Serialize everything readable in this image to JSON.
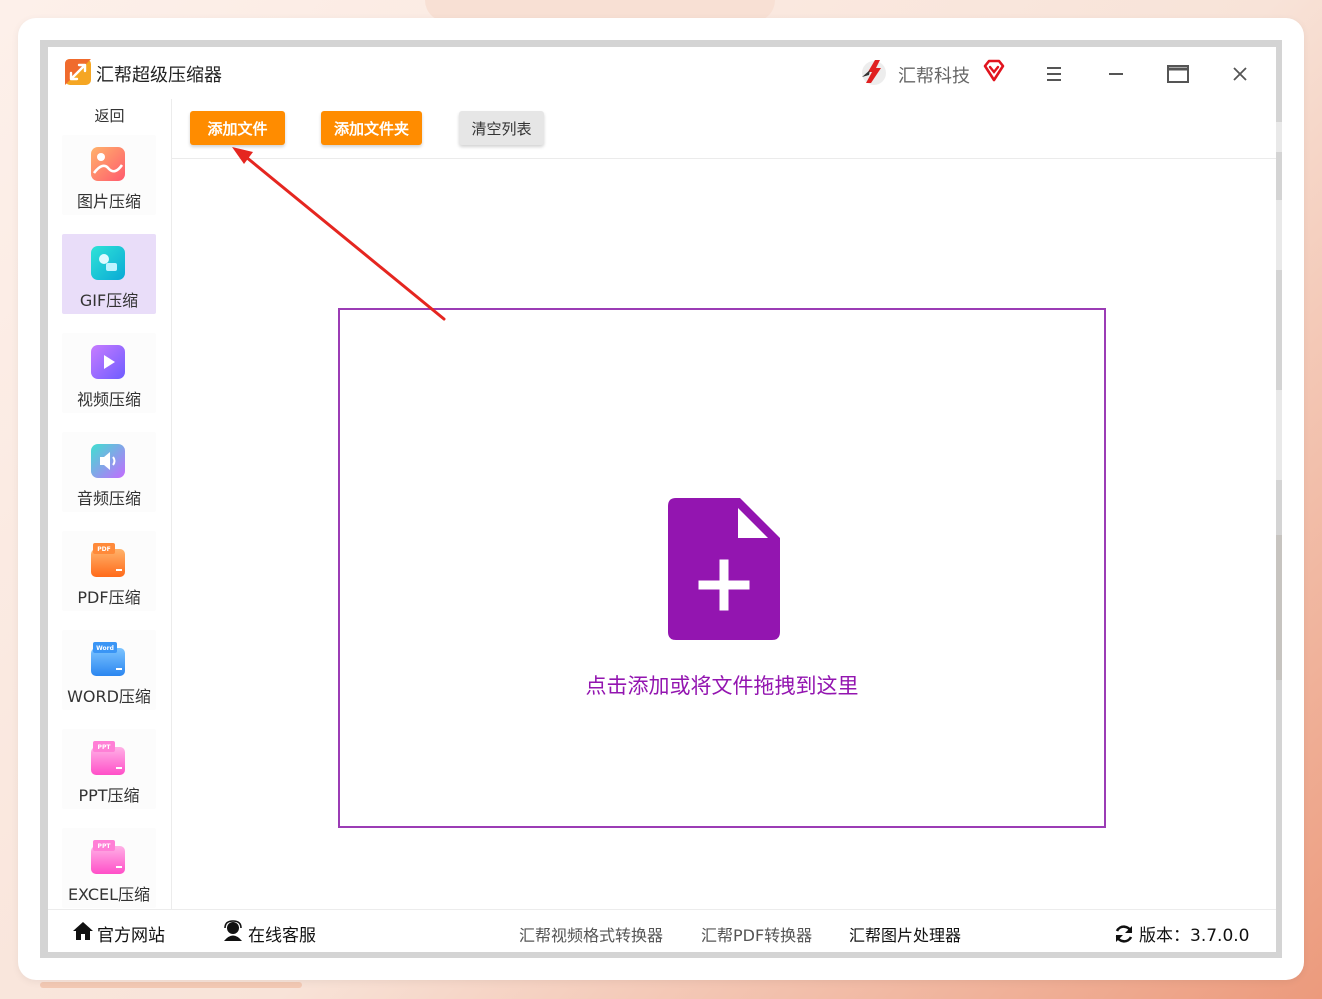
{
  "window": {
    "title": "汇帮超级压缩器",
    "brand": "汇帮科技"
  },
  "sidebar": {
    "back": "返回",
    "items": [
      {
        "label": "图片压缩",
        "icon": "image-compress-icon"
      },
      {
        "label": "GIF压缩",
        "icon": "gif-compress-icon",
        "active": true
      },
      {
        "label": "视频压缩",
        "icon": "video-compress-icon"
      },
      {
        "label": "音频压缩",
        "icon": "audio-compress-icon"
      },
      {
        "label": "PDF压缩",
        "icon": "pdf-compress-icon",
        "badge": "PDF"
      },
      {
        "label": "WORD压缩",
        "icon": "word-compress-icon",
        "badge": "Word"
      },
      {
        "label": "PPT压缩",
        "icon": "ppt-compress-icon",
        "badge": "PPT"
      },
      {
        "label": "EXCEL压缩",
        "icon": "excel-compress-icon",
        "badge": "PPT"
      }
    ]
  },
  "toolbar": {
    "add_file": "添加文件",
    "add_folder": "添加文件夹",
    "clear_list": "清空列表"
  },
  "dropzone": {
    "hint": "点击添加或将文件拖拽到这里"
  },
  "footer": {
    "website": "官方网站",
    "support": "在线客服",
    "links": [
      "汇帮视频格式转换器",
      "汇帮PDF转换器",
      "汇帮图片处理器"
    ],
    "version": "版本：3.7.0.0"
  },
  "colors": {
    "accent": "#ff8c00",
    "purple": "#9315b0",
    "active_bg": "#e9ddf9"
  }
}
